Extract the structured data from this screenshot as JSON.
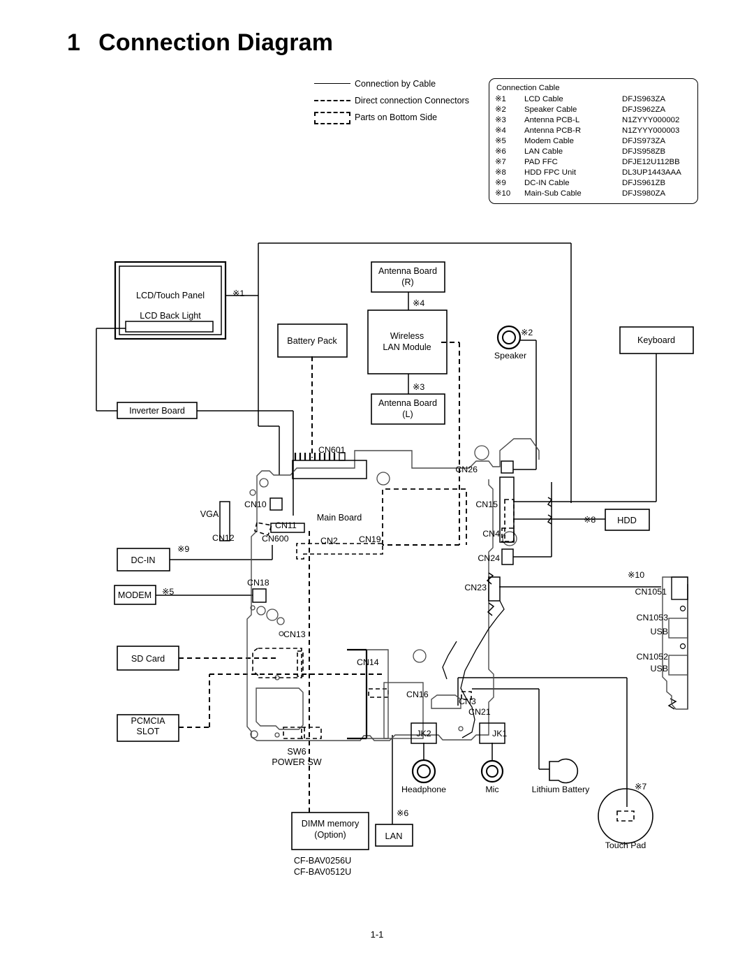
{
  "title": {
    "number": "1",
    "text": "Connection Diagram"
  },
  "legend": [
    {
      "style": "solid",
      "label": "Connection by Cable"
    },
    {
      "style": "dashed",
      "label": "Direct connection Connectors"
    },
    {
      "style": "box",
      "label": "Parts on Bottom Side"
    }
  ],
  "cable_table": {
    "title": "Connection Cable",
    "rows": [
      {
        "no": "※1",
        "name": "LCD Cable",
        "code": "DFJS963ZA"
      },
      {
        "no": "※2",
        "name": "Speaker Cable",
        "code": "DFJS962ZA"
      },
      {
        "no": "※3",
        "name": "Antenna PCB-L",
        "code": "N1ZYYY000002"
      },
      {
        "no": "※4",
        "name": "Antenna PCB-R",
        "code": "N1ZYYY000003"
      },
      {
        "no": "※5",
        "name": "Modem Cable",
        "code": "DFJS973ZA"
      },
      {
        "no": "※6",
        "name": "LAN Cable",
        "code": "DFJS958ZB"
      },
      {
        "no": "※7",
        "name": "PAD FFC",
        "code": "DFJE12U112BB"
      },
      {
        "no": "※8",
        "name": "HDD FPC Unit",
        "code": "DL3UP1443AAA"
      },
      {
        "no": "※9",
        "name": "DC-IN Cable",
        "code": "DFJS961ZB"
      },
      {
        "no": "※10",
        "name": "Main-Sub Cable",
        "code": "DFJS980ZA"
      }
    ]
  },
  "blocks": {
    "lcd_touch_panel": "LCD/Touch Panel",
    "lcd_back_light": "LCD Back Light",
    "inverter_board": "Inverter Board",
    "battery_pack": "Battery Pack",
    "antenna_board_r_line1": "Antenna Board",
    "antenna_board_r_line2": "(R)",
    "antenna_board_l_line1": "Antenna Board",
    "antenna_board_l_line2": "(L)",
    "wireless_lan_line1": "Wireless",
    "wireless_lan_line2": "LAN Module",
    "speaker": "Speaker",
    "keyboard": "Keyboard",
    "main_board": "Main Board",
    "hdd": "HDD",
    "dc_in": "DC-IN",
    "modem": "MODEM",
    "sd_card": "SD Card",
    "pcmcia_line1": "PCMCIA",
    "pcmcia_line2": "SLOT",
    "vga": "VGA",
    "sw6_line1": "SW6",
    "sw6_line2": "POWER SW",
    "dimm_line1": "DIMM memory",
    "dimm_line2": "(Option)",
    "dimm_part1": "CF-BAV0256U",
    "dimm_part2": "CF-BAV0512U",
    "lan": "LAN",
    "headphone": "Headphone",
    "mic": "Mic",
    "lithium_battery": "Lithium Battery",
    "touch_pad": "Touch Pad",
    "usb_1053": "USB",
    "usb_1052": "USB"
  },
  "connectors": {
    "cn601": "CN601",
    "cn10": "CN10",
    "cn11": "CN11",
    "cn12": "CN12",
    "cn600": "CN600",
    "cn18": "CN18",
    "cn13": "CN13",
    "cn2": "CN2",
    "cn19": "CN19",
    "cn14": "CN14",
    "cn16": "CN16",
    "cn3": "CN3",
    "cn21": "CN21",
    "jk1": "JK1",
    "jk2": "JK2",
    "cn26": "CN26",
    "cn15": "CN15",
    "cn4": "CN4",
    "cn24": "CN24",
    "cn23": "CN23",
    "cn1051": "CN1051",
    "cn1053": "CN1053",
    "cn1052": "CN1052"
  },
  "cable_marks": {
    "m1": "※1",
    "m2": "※2",
    "m3": "※3",
    "m4": "※4",
    "m5": "※5",
    "m6": "※6",
    "m7": "※7",
    "m8": "※8",
    "m9": "※9",
    "m10": "※10"
  },
  "footer": {
    "page": "1-1"
  }
}
